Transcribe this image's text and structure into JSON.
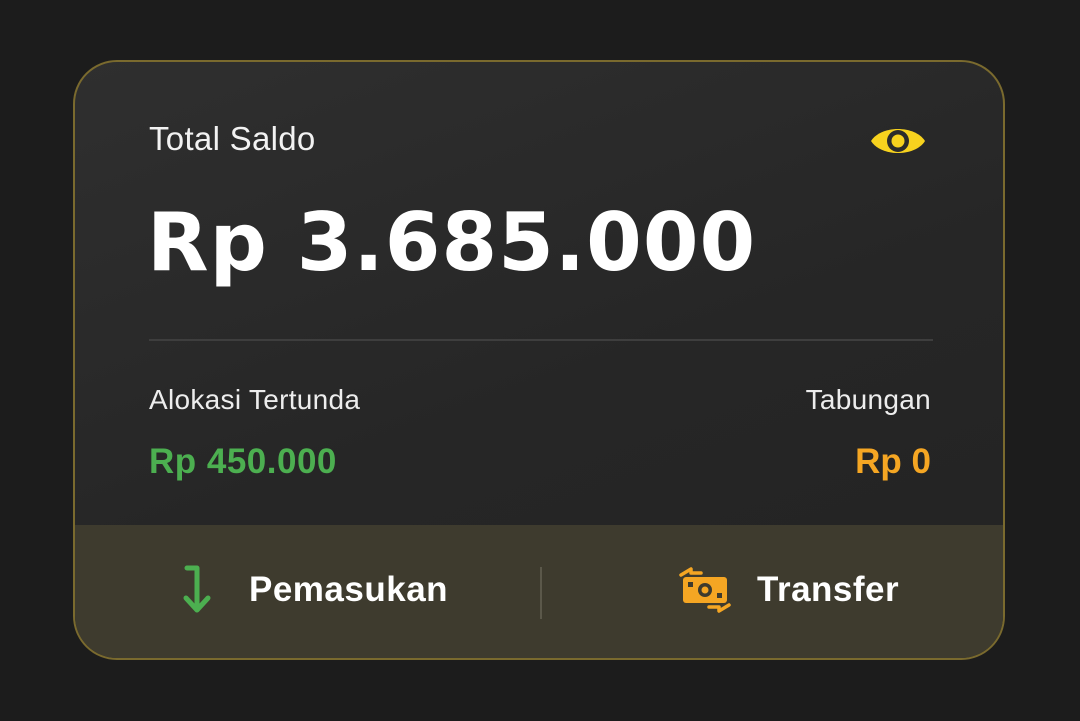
{
  "balance_card": {
    "total_label": "Total Saldo",
    "total_value": "Rp 3.685.000",
    "visibility_icon": "eye-icon",
    "pending": {
      "label": "Alokasi Tertunda",
      "value": "Rp 450.000",
      "color": "#4caf50"
    },
    "savings": {
      "label": "Tabungan",
      "value": "Rp 0",
      "color": "#f5a623"
    }
  },
  "actions": {
    "income": {
      "label": "Pemasukan",
      "icon": "arrow-down-icon"
    },
    "transfer": {
      "label": "Transfer",
      "icon": "money-transfer-icon"
    }
  },
  "colors": {
    "accent_yellow": "#f7d21e",
    "border": "#7a6a2e",
    "action_bar": "#3e3b2e"
  }
}
